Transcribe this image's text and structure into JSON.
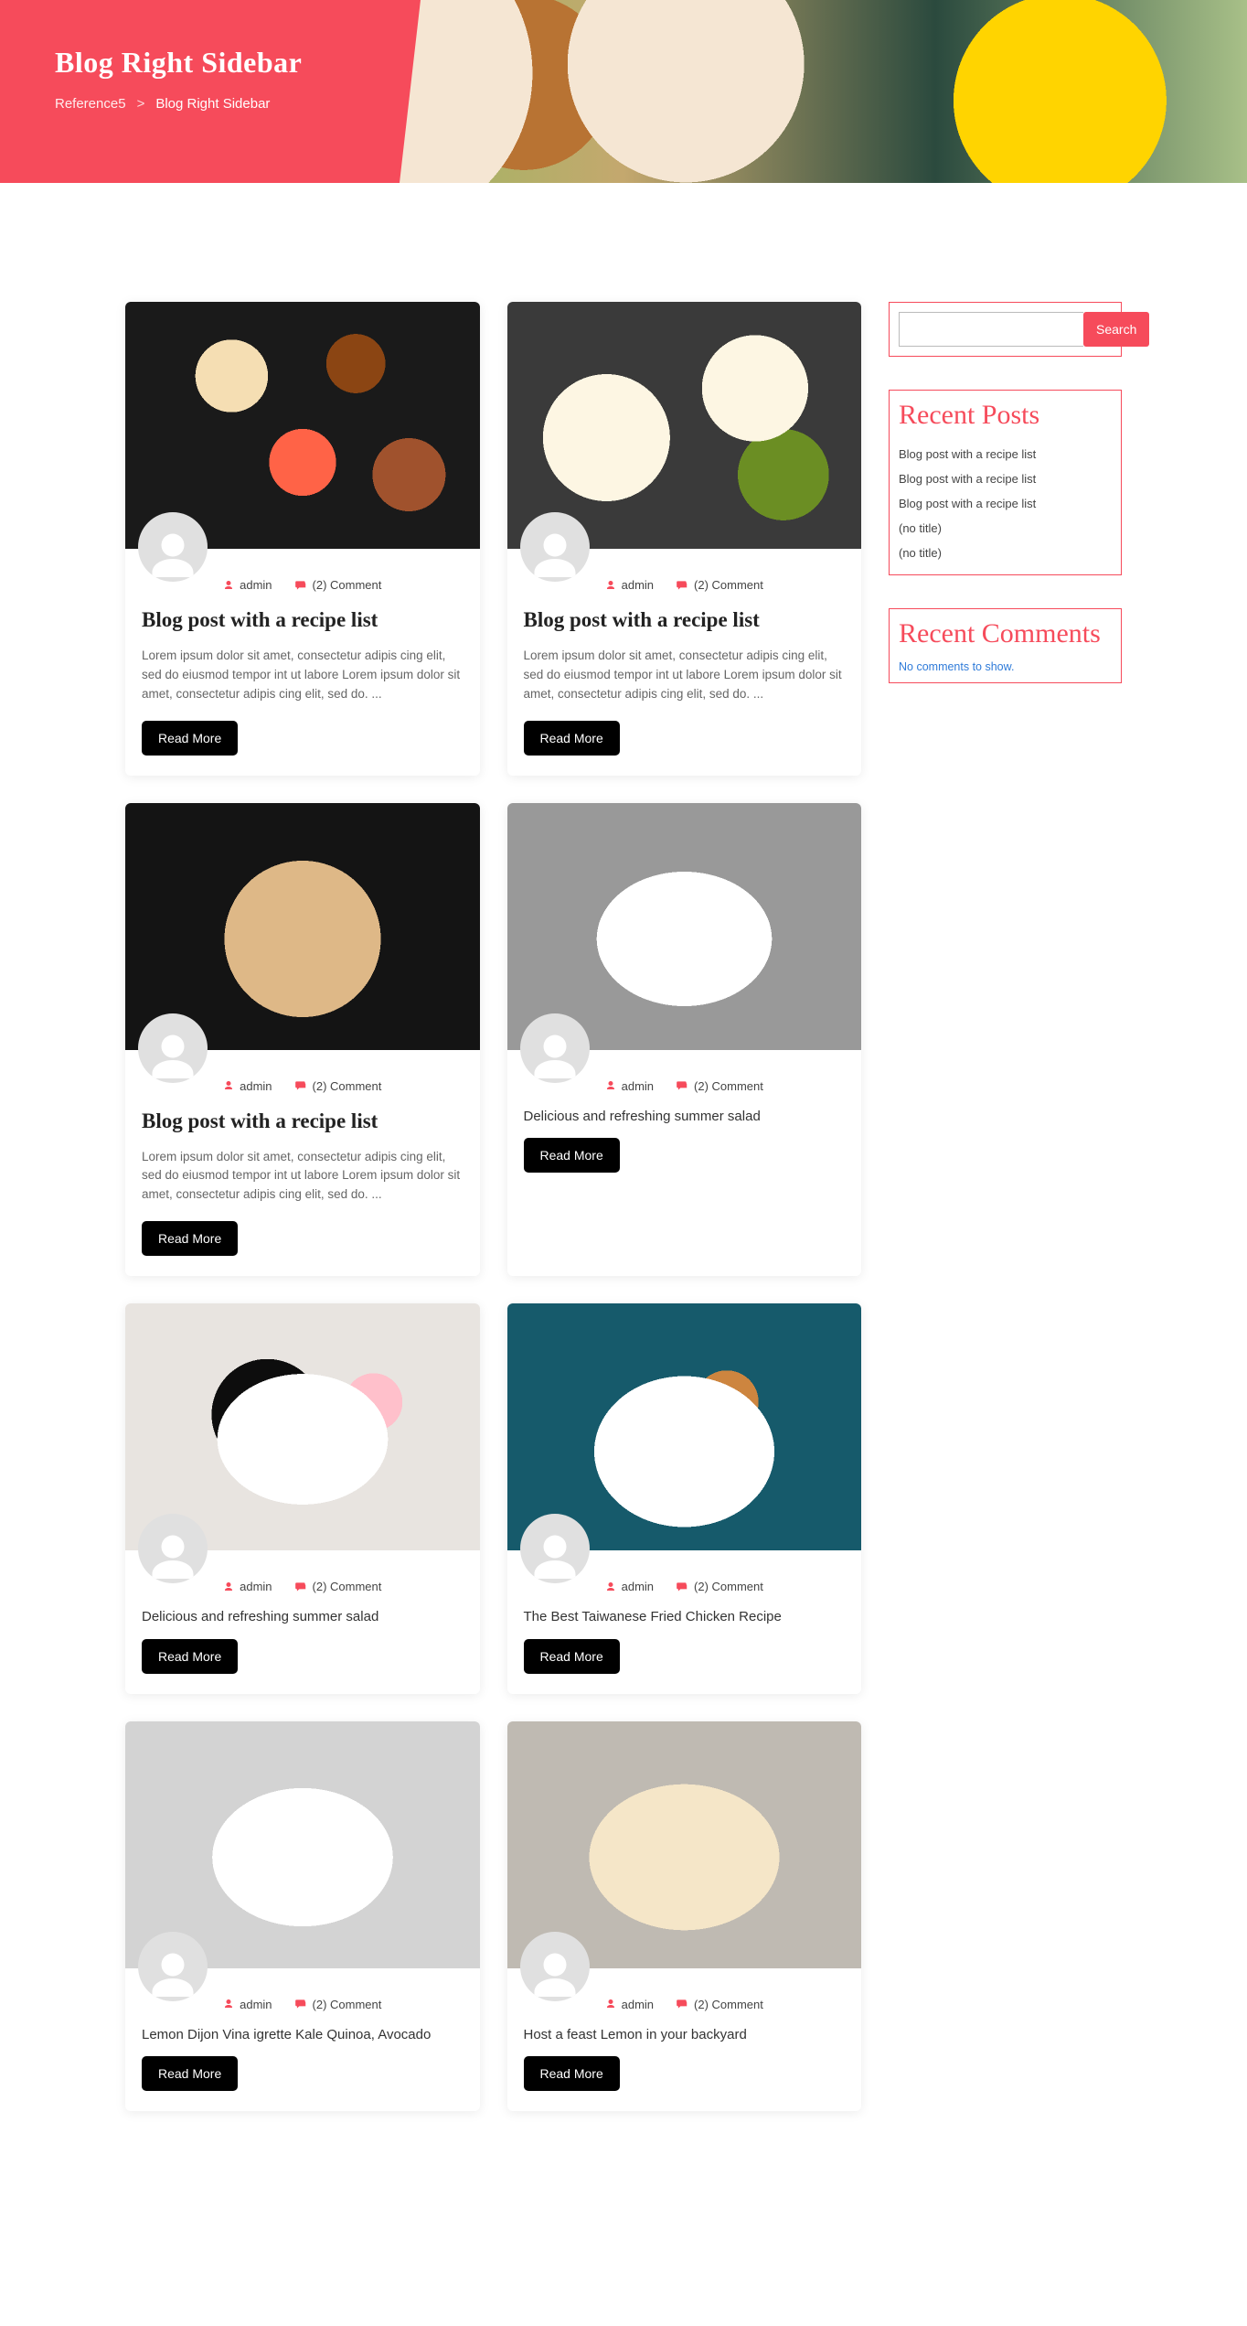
{
  "hero": {
    "title": "Blog Right Sidebar",
    "crumb_home": "Reference5",
    "crumb_sep": ">",
    "crumb_current": "Blog Right Sidebar"
  },
  "meta_labels": {
    "author": "admin",
    "comments": "(2) Comment",
    "read_more": "Read More"
  },
  "posts": [
    {
      "img": "fi1",
      "title": "Blog post with a recipe list",
      "title_style": "big",
      "excerpt": "Lorem ipsum dolor sit amet, consectetur adipis cing elit, sed do eiusmod tempor int ut labore Lorem ipsum dolor sit amet, consectetur adipis cing elit, sed do. ..."
    },
    {
      "img": "fi2",
      "title": "Blog post with a recipe list",
      "title_style": "big",
      "excerpt": "Lorem ipsum dolor sit amet, consectetur adipis cing elit, sed do eiusmod tempor int ut labore Lorem ipsum dolor sit amet, consectetur adipis cing elit, sed do. ..."
    },
    {
      "img": "fi3",
      "title": "Blog post with a recipe list",
      "title_style": "big",
      "excerpt": "Lorem ipsum dolor sit amet, consectetur adipis cing elit, sed do eiusmod tempor int ut labore Lorem ipsum dolor sit amet, consectetur adipis cing elit, sed do. ..."
    },
    {
      "img": "fi4",
      "title": "Delicious and refreshing summer salad",
      "title_style": "small",
      "excerpt": ""
    },
    {
      "img": "fi5",
      "title": "Delicious and refreshing summer salad",
      "title_style": "small",
      "excerpt": ""
    },
    {
      "img": "fi6",
      "title": "The Best Taiwanese Fried Chicken Recipe",
      "title_style": "small",
      "excerpt": ""
    },
    {
      "img": "fi7",
      "title": "Lemon Dijon Vina igrette Kale Quinoa, Avocado",
      "title_style": "small",
      "excerpt": ""
    },
    {
      "img": "fi8",
      "title": "Host a feast Lemon in your backyard",
      "title_style": "small",
      "excerpt": ""
    }
  ],
  "sidebar": {
    "search_button": "Search",
    "recent_posts_title": "Recent Posts",
    "recent_posts": [
      "Blog post with a recipe list",
      "Blog post with a recipe list",
      "Blog post with a recipe list",
      "(no title)",
      "(no title)"
    ],
    "recent_comments_title": "Recent Comments",
    "no_comments": "No comments to show."
  }
}
